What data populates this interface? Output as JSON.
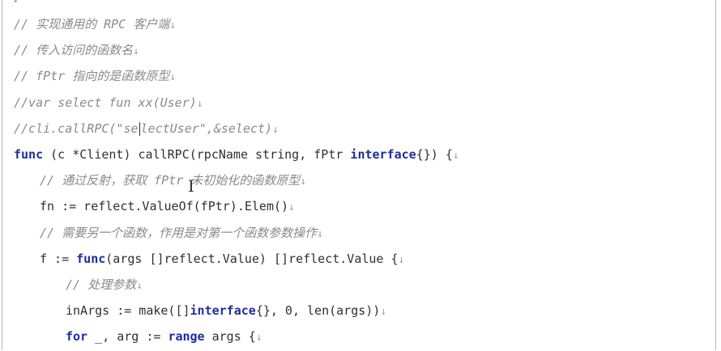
{
  "lines": [
    {
      "indent": 0,
      "parts": [
        {
          "cls": "comment",
          "text": "// 实现通用的 RPC 客户端"
        },
        {
          "cls": "mk",
          "text": "↓"
        }
      ]
    },
    {
      "indent": 0,
      "parts": [
        {
          "cls": "comment",
          "text": "// 传入访问的函数名"
        },
        {
          "cls": "mk",
          "text": "↓"
        }
      ]
    },
    {
      "indent": 0,
      "parts": [
        {
          "cls": "comment",
          "text": "// fPtr 指向的是函数原型"
        },
        {
          "cls": "mk",
          "text": "↓"
        }
      ]
    },
    {
      "indent": 0,
      "parts": [
        {
          "cls": "comment",
          "text": "//var select fun xx(User)"
        },
        {
          "cls": "mk",
          "text": "↓"
        }
      ]
    },
    {
      "indent": 0,
      "parts": [
        {
          "cls": "comment",
          "text": "//cli.callRPC(\"se"
        },
        {
          "cls": "cursor",
          "text": ""
        },
        {
          "cls": "comment",
          "text": "lectUser\",&select)"
        },
        {
          "cls": "mk",
          "text": "↓"
        }
      ]
    },
    {
      "indent": 0,
      "parts": [
        {
          "cls": "kw",
          "text": "func"
        },
        {
          "cls": "",
          "text": " (c *Client) callRPC(rpcName string, fPtr "
        },
        {
          "cls": "kw",
          "text": "interface"
        },
        {
          "cls": "",
          "text": "{}) {"
        },
        {
          "cls": "mk",
          "text": "↓"
        }
      ]
    },
    {
      "indent": 1,
      "parts": [
        {
          "cls": "comment",
          "text": "// 通过反射，获取 fPtr 未初始化的函数原型"
        },
        {
          "cls": "mk",
          "text": "↓"
        }
      ]
    },
    {
      "indent": 1,
      "parts": [
        {
          "cls": "",
          "text": "fn := reflect.ValueOf(fPtr).Elem()"
        },
        {
          "cls": "mk",
          "text": "↓"
        }
      ]
    },
    {
      "indent": 1,
      "parts": [
        {
          "cls": "comment",
          "text": "// 需要另一个函数，作用是对第一个函数参数操作"
        },
        {
          "cls": "mk",
          "text": "↓"
        }
      ]
    },
    {
      "indent": 1,
      "parts": [
        {
          "cls": "",
          "text": "f := "
        },
        {
          "cls": "kw",
          "text": "func"
        },
        {
          "cls": "",
          "text": "(args []reflect.Value) []reflect.Value {"
        },
        {
          "cls": "mk",
          "text": "↓"
        }
      ]
    },
    {
      "indent": 2,
      "parts": [
        {
          "cls": "comment",
          "text": "// 处理参数"
        },
        {
          "cls": "mk",
          "text": "↓"
        }
      ]
    },
    {
      "indent": 2,
      "parts": [
        {
          "cls": "",
          "text": "inArgs := make([]"
        },
        {
          "cls": "kw",
          "text": "interface"
        },
        {
          "cls": "",
          "text": "{}, 0, len(args))"
        },
        {
          "cls": "mk",
          "text": "↓"
        }
      ]
    },
    {
      "indent": 2,
      "parts": [
        {
          "cls": "kw",
          "text": "for"
        },
        {
          "cls": "",
          "text": " _, arg := "
        },
        {
          "cls": "kw",
          "text": "range"
        },
        {
          "cls": "",
          "text": " args {"
        },
        {
          "cls": "mk",
          "text": "↓"
        }
      ]
    }
  ]
}
